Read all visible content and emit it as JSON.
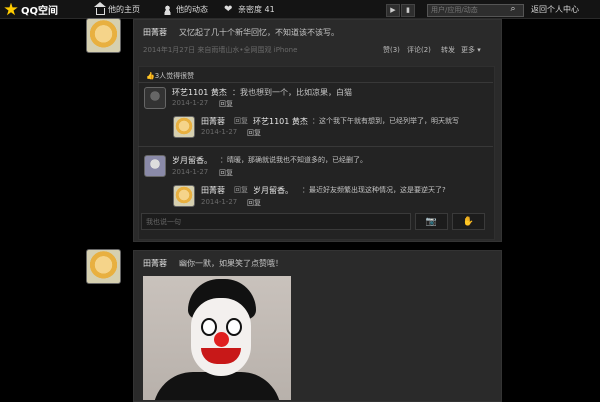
{
  "topbar": {
    "logo_text": "QQ空间",
    "nav": [
      {
        "label": "他的主页",
        "icon": "home-icon"
      },
      {
        "label": "他的动态",
        "icon": "people-icon"
      },
      {
        "label": "亲密度 41",
        "icon": "heart-icon"
      }
    ],
    "search_placeholder": "用户/应用/动态",
    "return_label": "返回个人中心"
  },
  "post1": {
    "author": "田菁蓉",
    "text": "又忆起了几十个新华回忆，不知道该不该写。",
    "meta": "2014年1月27日  来自雨墙山水•全网围观 iPhone",
    "actions": [
      "赞(3)",
      "评论(2)",
      "转发",
      "更多 ▾"
    ],
    "likes": "3人觉得很赞",
    "comments": [
      {
        "author": "环艺1101 黄杰",
        "text": "：我也想到一个，比如凉果，白猫",
        "date": "2014-1-27",
        "reply": "回复"
      },
      {
        "author": "田菁蓉",
        "reply_word": "回复",
        "target": "环艺1101 黄杰",
        "text": "：这个我下午就有想到，已经列举了，明天就写",
        "date": "2014-1-27",
        "reply": "回复"
      },
      {
        "author": "岁月留香。",
        "text": "：晴暖，那确就说我也不知道多的，已经删了。",
        "date": "2014-1-27",
        "reply": "回复"
      },
      {
        "author": "田菁蓉",
        "reply_word": "回复",
        "target": "岁月留香。",
        "text": "：最近好友频繁出现这种情况，这是要逆天了?",
        "date": "2014-1-27",
        "reply": "回复"
      }
    ],
    "input_placeholder": "我也说一句"
  },
  "post2": {
    "author": "田菁蓉",
    "text": "幽你一默，如果笑了点赞哦！"
  },
  "colors": {
    "bg": "#000000",
    "panel": "#2a2a2a",
    "accent": "#ffcc00"
  }
}
